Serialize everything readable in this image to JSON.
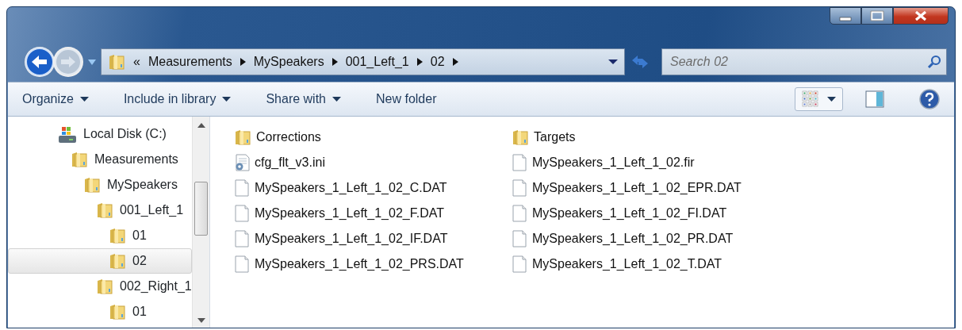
{
  "window": {
    "caption_buttons": [
      {
        "kind": "minimize"
      },
      {
        "kind": "maximize"
      },
      {
        "kind": "close"
      }
    ]
  },
  "address_bar": {
    "overflow": "«",
    "crumbs": [
      "Measurements",
      "MySpeakers",
      "001_Left_1",
      "02"
    ]
  },
  "search": {
    "placeholder": "Search 02"
  },
  "toolbar": [
    {
      "label": "Organize",
      "has_menu": true
    },
    {
      "label": "Include in library",
      "has_menu": true
    },
    {
      "label": "Share with",
      "has_menu": true
    },
    {
      "label": "New folder",
      "has_menu": false
    }
  ],
  "nav_tree": [
    {
      "label": "Local Disk (C:)",
      "kind": "drive",
      "selected": false,
      "children": [
        {
          "label": "Measurements",
          "kind": "folder",
          "selected": false,
          "children": [
            {
              "label": "MySpeakers",
              "kind": "folder",
              "selected": false,
              "children": [
                {
                  "label": "001_Left_1",
                  "kind": "folder",
                  "selected": false,
                  "children": [
                    {
                      "label": "01",
                      "kind": "folder",
                      "selected": false
                    },
                    {
                      "label": "02",
                      "kind": "folder",
                      "selected": true
                    }
                  ]
                },
                {
                  "label": "002_Right_1",
                  "kind": "folder",
                  "selected": false,
                  "children": [
                    {
                      "label": "01",
                      "kind": "folder",
                      "selected": false
                    }
                  ]
                }
              ]
            }
          ]
        }
      ]
    }
  ],
  "files": [
    {
      "name": "Corrections",
      "kind": "folder"
    },
    {
      "name": "cfg_flt_v3.ini",
      "kind": "settings"
    },
    {
      "name": "MySpeakers_1_Left_1_02_C.DAT",
      "kind": "file"
    },
    {
      "name": "MySpeakers_1_Left_1_02_F.DAT",
      "kind": "file"
    },
    {
      "name": "MySpeakers_1_Left_1_02_IF.DAT",
      "kind": "file"
    },
    {
      "name": "MySpeakers_1_Left_1_02_PRS.DAT",
      "kind": "file"
    },
    {
      "name": "Targets",
      "kind": "folder"
    },
    {
      "name": "MySpeakers_1_Left_1_02.fir",
      "kind": "file"
    },
    {
      "name": "MySpeakers_1_Left_1_02_EPR.DAT",
      "kind": "file"
    },
    {
      "name": "MySpeakers_1_Left_1_02_FI.DAT",
      "kind": "file"
    },
    {
      "name": "MySpeakers_1_Left_1_02_PR.DAT",
      "kind": "file"
    },
    {
      "name": "MySpeakers_1_Left_1_02_T.DAT",
      "kind": "file"
    }
  ]
}
